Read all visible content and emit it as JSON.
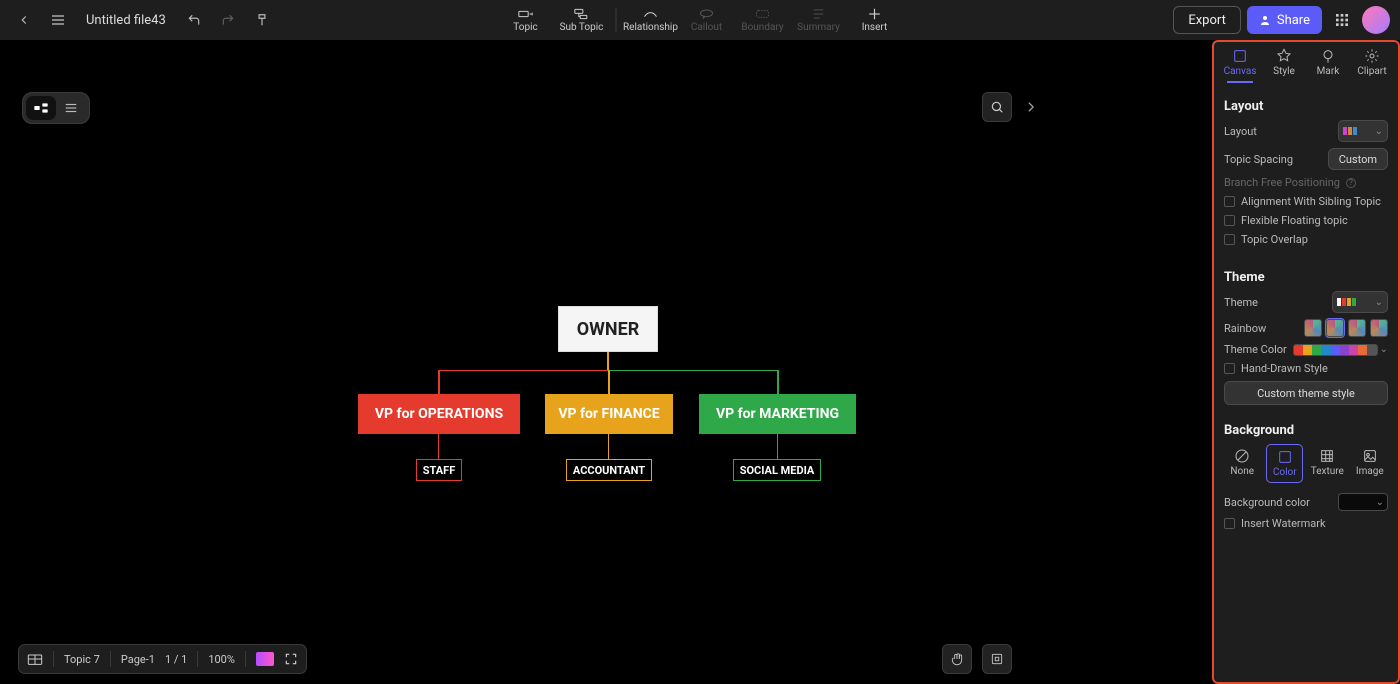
{
  "header": {
    "doc_title": "Untitled file43",
    "export_label": "Export",
    "share_label": "Share",
    "tools": [
      {
        "label": "Topic",
        "enabled": true
      },
      {
        "label": "Sub Topic",
        "enabled": true
      },
      {
        "label": "Relationship",
        "enabled": true
      },
      {
        "label": "Callout",
        "enabled": false
      },
      {
        "label": "Boundary",
        "enabled": false
      },
      {
        "label": "Summary",
        "enabled": false
      },
      {
        "label": "Insert",
        "enabled": true
      }
    ]
  },
  "chart": {
    "root": "OWNER",
    "vps": [
      {
        "label": "VP for OPERATIONS",
        "color": "#e53b2e",
        "child": "STAFF"
      },
      {
        "label": "VP for FINANCE",
        "color": "#e7a31c",
        "child": "ACCOUNTANT"
      },
      {
        "label": "VP for MARKETING",
        "color": "#2fa84a",
        "child": "SOCIAL MEDIA"
      }
    ]
  },
  "panel": {
    "tabs": [
      "Canvas",
      "Style",
      "Mark",
      "Clipart"
    ],
    "active_tab": "Canvas",
    "sections": {
      "layout": {
        "title": "Layout",
        "layout_label": "Layout",
        "spacing_label": "Topic Spacing",
        "spacing_value": "Custom",
        "branch_free": "Branch Free Positioning",
        "align_sibling": "Alignment With Sibling Topic",
        "flex_float": "Flexible Floating topic",
        "overlap": "Topic Overlap"
      },
      "theme": {
        "title": "Theme",
        "theme_label": "Theme",
        "rainbow_label": "Rainbow",
        "theme_color_label": "Theme Color",
        "hand_drawn": "Hand-Drawn Style",
        "custom_btn": "Custom theme style",
        "colors": [
          "#e53b2e",
          "#e7a31c",
          "#2fa84a",
          "#2288cc",
          "#5b5bf7",
          "#8844cc",
          "#cc44aa",
          "#e86a3a",
          "#555555"
        ]
      },
      "background": {
        "title": "Background",
        "opts": [
          "None",
          "Color",
          "Texture",
          "Image"
        ],
        "selected": "Color",
        "bg_color_label": "Background color",
        "watermark": "Insert Watermark"
      }
    }
  },
  "status": {
    "topic": "Topic 7",
    "page": "Page-1",
    "page_num": "1 / 1",
    "zoom": "100%"
  }
}
